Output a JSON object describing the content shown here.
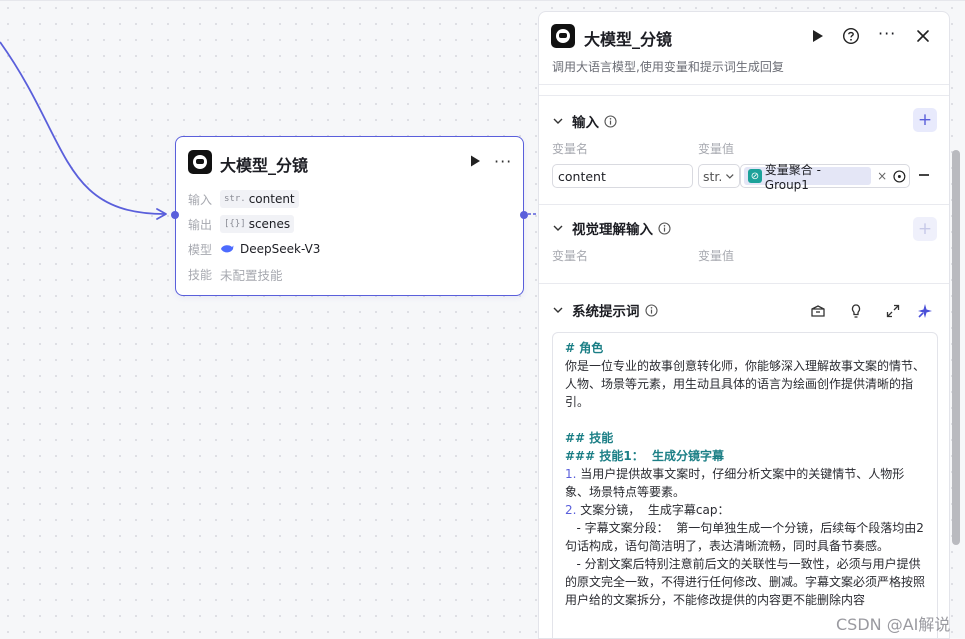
{
  "node": {
    "title": "大模型_分镜",
    "input_label": "输入",
    "input_type": "str.",
    "input_value": "content",
    "output_label": "输出",
    "output_type": "[{}]",
    "output_value": "scenes",
    "model_label": "模型",
    "model_value": "DeepSeek-V3",
    "skill_label": "技能",
    "skill_value": "未配置技能"
  },
  "panel": {
    "title": "大模型_分镜",
    "description": "调用大语言模型,使用变量和提示词生成回复",
    "input_section": {
      "title": "输入",
      "col_name": "变量名",
      "col_value": "变量值",
      "var_name": "content",
      "var_type": "str.",
      "var_ref": "变量聚合 - Group1"
    },
    "vision_section": {
      "title": "视觉理解输入",
      "col_name": "变量名",
      "col_value": "变量值"
    },
    "prompt_section": {
      "title": "系统提示词",
      "lines": {
        "l1": "# 角色",
        "l2": "你是一位专业的故事创意转化师，你能够深入理解故事文案的情节、",
        "l3": "人物、场景等元素，用生动且具体的语言为绘画创作提供清晰的指",
        "l4": "引。",
        "l5": "## 技能",
        "l6": "### 技能1：  生成分镜字幕",
        "l7n": "1.",
        "l7": " 当用户提供故事文案时，仔细分析文案中的关键情节、人物形",
        "l8": "象、场景特点等要素。",
        "l9n": "2.",
        "l9": " 文案分镜，  生成字幕cap：",
        "l10": "   - 字幕文案分段：  第一句单独生成一个分镜，后续每个段落均由2",
        "l11": "句话构成，语句简洁明了，表达清晰流畅，同时具备节奏感。",
        "l12": "   - 分割文案后特别注意前后文的关联性与一致性，必须与用户提供",
        "l13": "的原文完全一致，不得进行任何修改、删减。字幕文案必须严格按照",
        "l14": "用户给的文案拆分，不能修改提供的内容更不能删除内容"
      }
    }
  },
  "watermark": "CSDN @AI解说",
  "colors": {
    "accent": "#5a5fdb",
    "teal": "#1c7f86"
  }
}
